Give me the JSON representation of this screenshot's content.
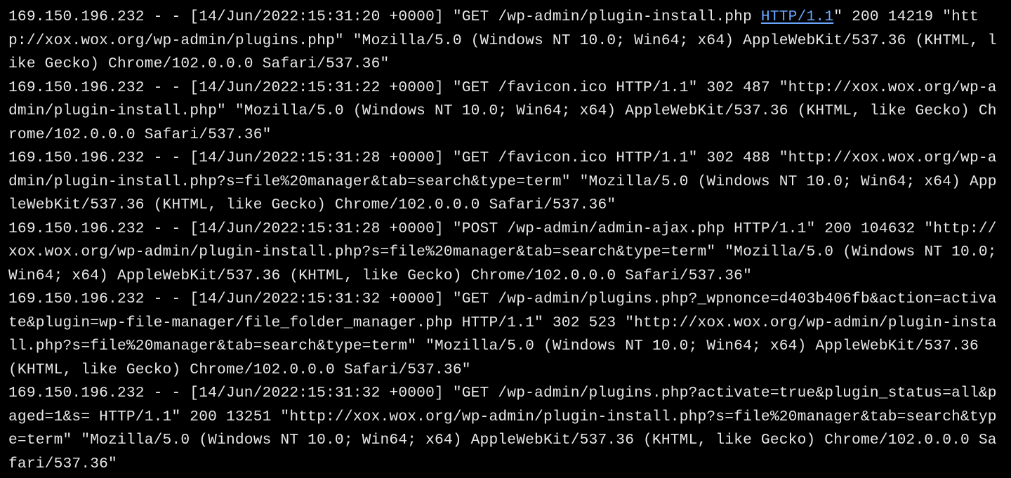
{
  "log": {
    "lines": [
      {
        "pre": "169.150.196.232 - - [14/Jun/2022:15:31:20 +0000] \"GET /wp-admin/plugin-install.php ",
        "hl": "HTTP/1.1",
        "post": "\" 200 14219 \"http://xox.wox.org/wp-admin/plugins.php\" \"Mozilla/5.0 (Windows NT 10.0; Win64; x64) AppleWebKit/537.36 (KHTML, like Gecko) Chrome/102.0.0.0 Safari/537.36\""
      },
      {
        "pre": "169.150.196.232 - - [14/Jun/2022:15:31:22 +0000] \"GET /favicon.ico HTTP/1.1\" 302 487 \"http://xox.wox.org/wp-admin/plugin-install.php\" \"Mozilla/5.0 (Windows NT 10.0; Win64; x64) AppleWebKit/537.36 (KHTML, like Gecko) Chrome/102.0.0.0 Safari/537.36\"",
        "hl": "",
        "post": ""
      },
      {
        "pre": "169.150.196.232 - - [14/Jun/2022:15:31:28 +0000] \"GET /favicon.ico HTTP/1.1\" 302 488 \"http://xox.wox.org/wp-admin/plugin-install.php?s=file%20manager&tab=search&type=term\" \"Mozilla/5.0 (Windows NT 10.0; Win64; x64) AppleWebKit/537.36 (KHTML, like Gecko) Chrome/102.0.0.0 Safari/537.36\"",
        "hl": "",
        "post": ""
      },
      {
        "pre": "169.150.196.232 - - [14/Jun/2022:15:31:28 +0000] \"POST /wp-admin/admin-ajax.php HTTP/1.1\" 200 104632 \"http://xox.wox.org/wp-admin/plugin-install.php?s=file%20manager&tab=search&type=term\" \"Mozilla/5.0 (Windows NT 10.0; Win64; x64) AppleWebKit/537.36 (KHTML, like Gecko) Chrome/102.0.0.0 Safari/537.36\"",
        "hl": "",
        "post": ""
      },
      {
        "pre": "169.150.196.232 - - [14/Jun/2022:15:31:32 +0000] \"GET /wp-admin/plugins.php?_wpnonce=d403b406fb&action=activate&plugin=wp-file-manager/file_folder_manager.php HTTP/1.1\" 302 523 \"http://xox.wox.org/wp-admin/plugin-install.php?s=file%20manager&tab=search&type=term\" \"Mozilla/5.0 (Windows NT 10.0; Win64; x64) AppleWebKit/537.36 (KHTML, like Gecko) Chrome/102.0.0.0 Safari/537.36\"",
        "hl": "",
        "post": ""
      },
      {
        "pre": "169.150.196.232 - - [14/Jun/2022:15:31:32 +0000] \"GET /wp-admin/plugins.php?activate=true&plugin_status=all&paged=1&s= HTTP/1.1\" 200 13251 \"http://xox.wox.org/wp-admin/plugin-install.php?s=file%20manager&tab=search&type=term\" \"Mozilla/5.0 (Windows NT 10.0; Win64; x64) AppleWebKit/537.36 (KHTML, like Gecko) Chrome/102.0.0.0 Safari/537.36\"",
        "hl": "",
        "post": ""
      }
    ]
  }
}
